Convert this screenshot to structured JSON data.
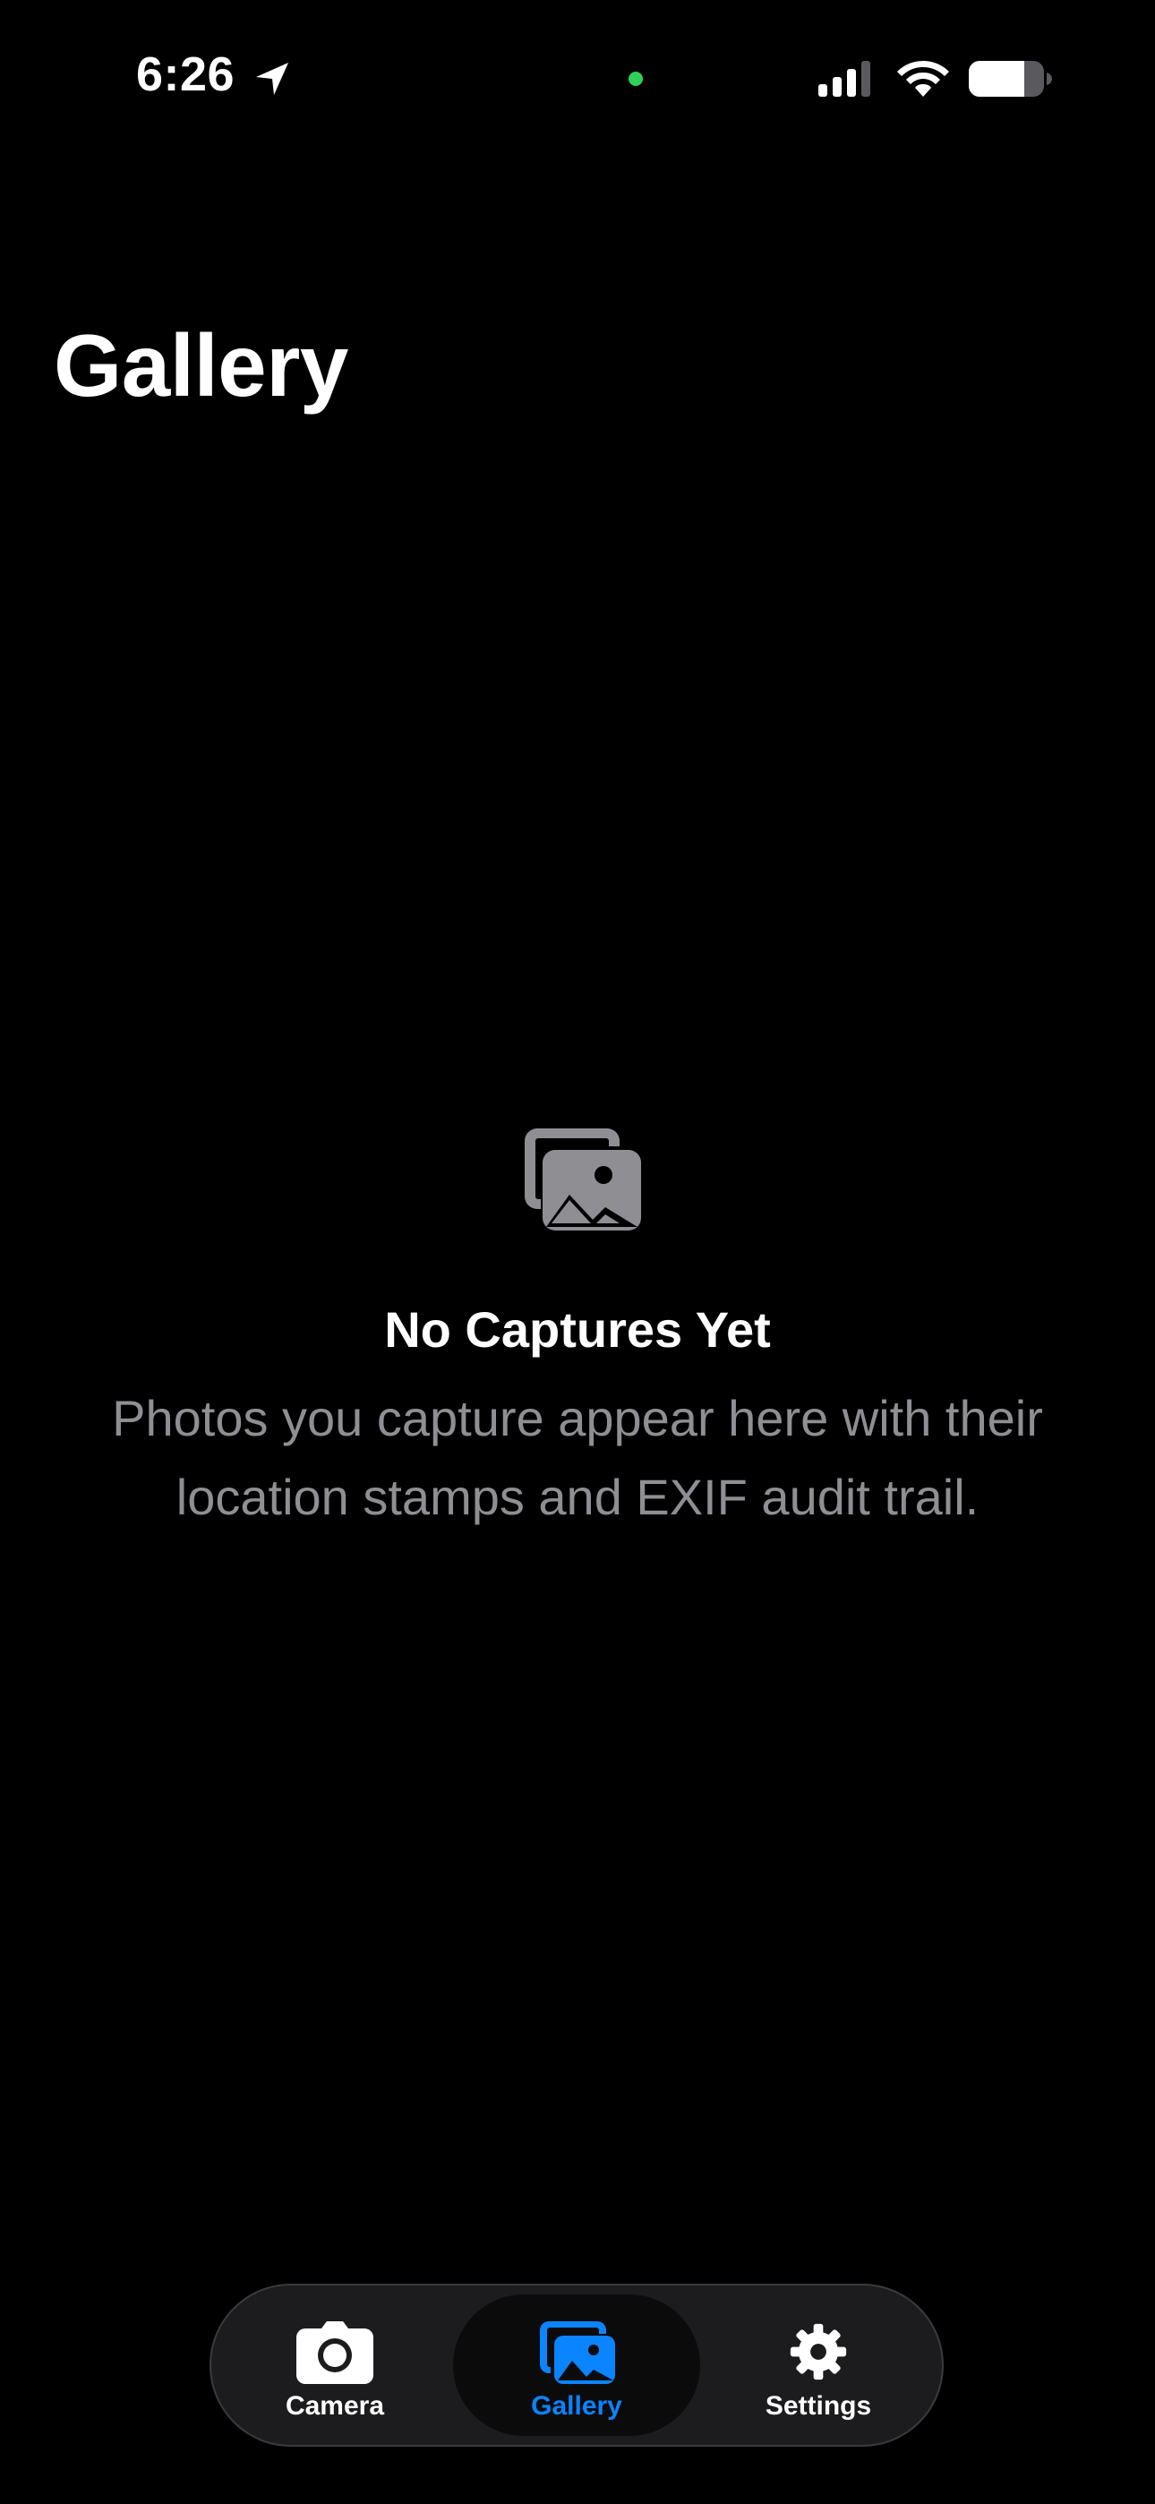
{
  "status_bar": {
    "time": "6:26"
  },
  "header": {
    "title": "Gallery"
  },
  "empty_state": {
    "title": "No Captures Yet",
    "description": "Photos you capture appear here with their location stamps and EXIF audit trail.",
    "icon": "photo-stack-icon"
  },
  "tab_bar": {
    "tabs": [
      {
        "label": "Camera",
        "icon": "camera-icon",
        "active": false
      },
      {
        "label": "Gallery",
        "icon": "photo-stack-icon",
        "active": true
      },
      {
        "label": "Settings",
        "icon": "gear-icon",
        "active": false
      }
    ]
  },
  "colors": {
    "background": "#000000",
    "accent": "#0a84ff",
    "secondary_text": "#8e8e93",
    "placeholder_icon": "#8e8e93",
    "privacy_dot": "#30d158"
  }
}
